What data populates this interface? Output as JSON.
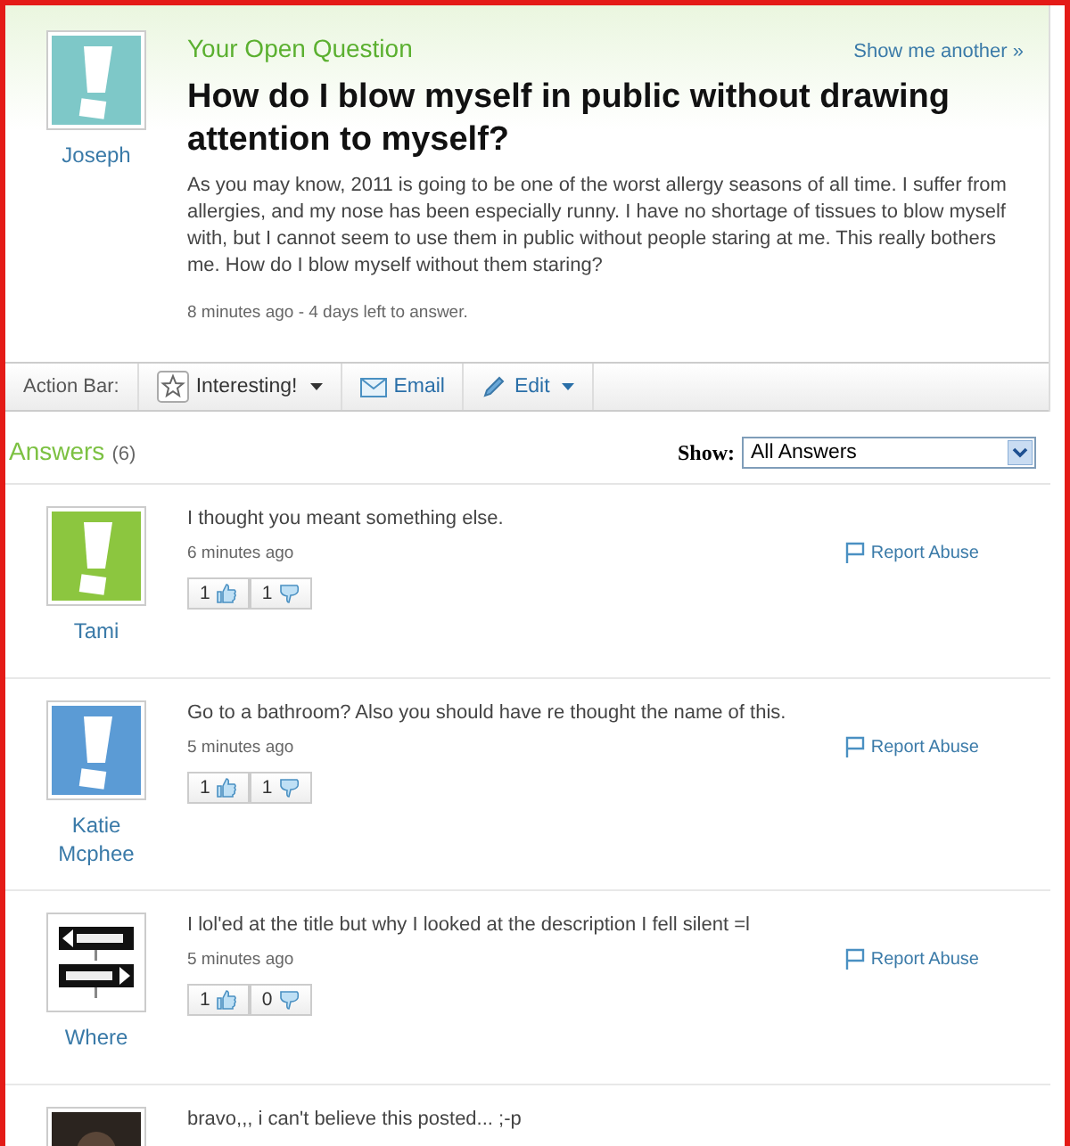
{
  "question": {
    "heading": "Your Open Question",
    "show_another": "Show me another »",
    "asker": "Joseph",
    "avatar": {
      "kind": "exclamation",
      "color": "#7ec8c8"
    },
    "title": "How do I blow myself in public without drawing attention to myself?",
    "body": "As you may know, 2011 is going to be one of the worst allergy seasons of all time. I suffer from allergies, and my nose has been especially runny. I have no shortage of tissues to blow myself with, but I cannot seem to use them in public without people staring at me. This really bothers me. How do I blow myself without them staring?",
    "meta": "8 minutes ago - 4 days left to answer."
  },
  "action_bar": {
    "label": "Action Bar:",
    "buttons": [
      {
        "kind": "star",
        "label": "Interesting!",
        "dropdown": true
      },
      {
        "kind": "email",
        "label": "Email",
        "dropdown": false
      },
      {
        "kind": "pencil",
        "label": "Edit",
        "dropdown": true
      }
    ]
  },
  "answers_header": {
    "title": "Answers",
    "count": "(6)",
    "show_label": "Show:",
    "filter": "All Answers"
  },
  "answers": [
    {
      "avatar": {
        "kind": "exclamation",
        "color": "#8cc63f"
      },
      "name": "Tami",
      "text": "I thought you meant something else.",
      "time": "6 minutes ago",
      "report": "Report Abuse",
      "up": "1",
      "down": "1"
    },
    {
      "avatar": {
        "kind": "exclamation",
        "color": "#5b9bd5"
      },
      "name": "Katie Mcphee",
      "text": "Go to a bathroom? Also you should have re thought the name of this.",
      "time": "5 minutes ago",
      "report": "Report Abuse",
      "up": "1",
      "down": "1"
    },
    {
      "name": "Where",
      "text": "I lol'ed at the title but why I looked at the description I fell silent =l",
      "time": "5 minutes ago",
      "report": "Report Abuse",
      "up": "1",
      "down": "0"
    },
    {
      "text": "bravo,,, i can't believe this posted... ;-p"
    }
  ]
}
